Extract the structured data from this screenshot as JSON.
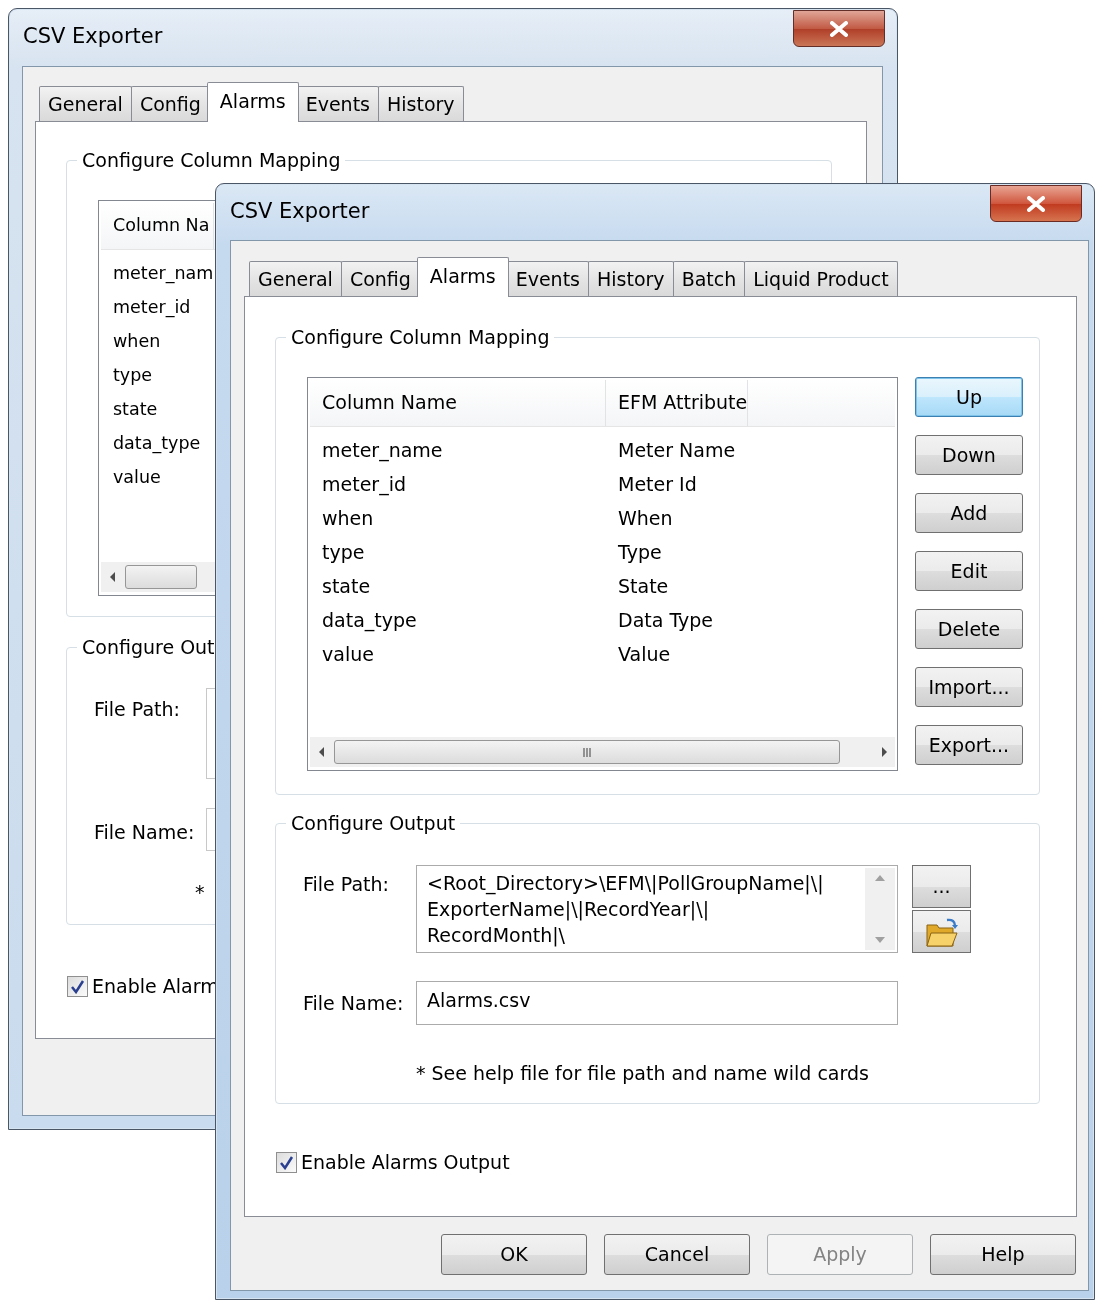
{
  "windows": [
    {
      "title": "CSV Exporter",
      "active": false,
      "tabs": [
        {
          "label": "General",
          "selected": false
        },
        {
          "label": "Config",
          "selected": false
        },
        {
          "label": "Alarms",
          "selected": true
        },
        {
          "label": "Events",
          "selected": false
        },
        {
          "label": "History",
          "selected": false
        }
      ],
      "column_mapping": {
        "title": "Configure Column Mapping",
        "columns": [
          "Column Na"
        ],
        "rows": [
          [
            "meter_nam"
          ],
          [
            "meter_id"
          ],
          [
            "when"
          ],
          [
            "type"
          ],
          [
            "state"
          ],
          [
            "data_type"
          ],
          [
            "value"
          ]
        ]
      },
      "output": {
        "title": "Configure Out",
        "file_path_label": "File Path:",
        "file_name_label": "File Name:",
        "note": "*"
      },
      "enable_output": {
        "label": "Enable Alarm",
        "checked": true
      }
    },
    {
      "title": "CSV Exporter",
      "active": true,
      "tabs": [
        {
          "label": "General",
          "selected": false
        },
        {
          "label": "Config",
          "selected": false
        },
        {
          "label": "Alarms",
          "selected": true
        },
        {
          "label": "Events",
          "selected": false
        },
        {
          "label": "History",
          "selected": false
        },
        {
          "label": "Batch",
          "selected": false
        },
        {
          "label": "Liquid Product",
          "selected": false
        }
      ],
      "column_mapping": {
        "title": "Configure Column Mapping",
        "columns": [
          "Column Name",
          "EFM Attribute"
        ],
        "rows": [
          [
            "meter_name",
            "Meter Name"
          ],
          [
            "meter_id",
            "Meter Id"
          ],
          [
            "when",
            "When"
          ],
          [
            "type",
            "Type"
          ],
          [
            "state",
            "State"
          ],
          [
            "data_type",
            "Data Type"
          ],
          [
            "value",
            "Value"
          ]
        ],
        "buttons": [
          {
            "label": "Up",
            "focused": true
          },
          {
            "label": "Down",
            "focused": false
          },
          {
            "label": "Add",
            "focused": false
          },
          {
            "label": "Edit",
            "focused": false
          },
          {
            "label": "Delete",
            "focused": false
          },
          {
            "label": "Import...",
            "focused": false
          },
          {
            "label": "Export...",
            "focused": false
          }
        ]
      },
      "output": {
        "title": "Configure Output",
        "file_path_label": "File Path:",
        "file_path_lines": [
          "<Root_Directory>\\EFM\\|PollGroupName|\\|",
          "ExporterName|\\|RecordYear|\\|",
          "RecordMonth|\\"
        ],
        "browse_label": "...",
        "file_name_label": "File Name:",
        "file_name": "Alarms.csv",
        "note": "* See help file for file path and name wild cards"
      },
      "enable_output": {
        "label": "Enable Alarms Output",
        "checked": true
      },
      "dialog_buttons": [
        {
          "label": "OK",
          "disabled": false
        },
        {
          "label": "Cancel",
          "disabled": false
        },
        {
          "label": "Apply",
          "disabled": true
        },
        {
          "label": "Help",
          "disabled": false
        }
      ]
    }
  ]
}
